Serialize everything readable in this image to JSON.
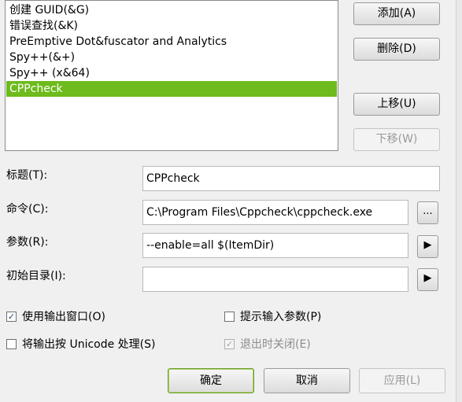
{
  "tools_list": {
    "items": [
      "创建 GUID(&G)",
      "错误查找(&K)",
      "PreEmptive Dot&fuscator and Analytics",
      "Spy++(&+)",
      "Spy++ (x&64)",
      "CPPcheck"
    ],
    "selected_index": 5,
    "selection_color": "#6dbb1c"
  },
  "side_buttons": {
    "add": "添加(A)",
    "delete": "删除(D)",
    "move_up": "上移(U)",
    "move_down": "下移(W)"
  },
  "form": {
    "title_label": "标题(T):",
    "title_value": "CPPcheck",
    "command_label": "命令(C):",
    "command_value": "C:\\Program Files\\Cppcheck\\cppcheck.exe",
    "browse_label": "...",
    "args_label": "参数(R):",
    "args_value": "--enable=all $(ItemDir)",
    "initdir_label": "初始目录(I):",
    "initdir_value": "",
    "arrow_glyph": "▶"
  },
  "options": {
    "use_output_window": {
      "label": "使用输出窗口(O)",
      "checked": true
    },
    "prompt_args": {
      "label": "提示输入参数(P)",
      "checked": false
    },
    "unicode_output": {
      "label": "将输出按 Unicode 处理(S)",
      "checked": false
    },
    "close_on_exit": {
      "label": "退出时关闭(E)",
      "checked": true,
      "disabled": true
    },
    "check_glyph": "✓"
  },
  "footer": {
    "ok": "确定",
    "cancel": "取消",
    "apply": "应用(L)"
  }
}
